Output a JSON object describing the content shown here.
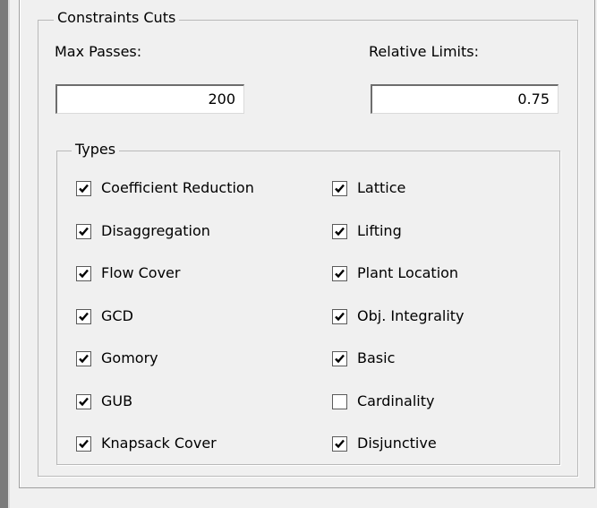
{
  "constraints_cuts": {
    "title": "Constraints Cuts",
    "max_passes": {
      "label": "Max Passes:",
      "value": "200"
    },
    "relative_limits": {
      "label": "Relative Limits:",
      "value": "0.75"
    },
    "types": {
      "title": "Types",
      "left": [
        {
          "label": "Coefficient Reduction",
          "checked": true
        },
        {
          "label": "Disaggregation",
          "checked": true
        },
        {
          "label": "Flow Cover",
          "checked": true
        },
        {
          "label": "GCD",
          "checked": true
        },
        {
          "label": "Gomory",
          "checked": true
        },
        {
          "label": "GUB",
          "checked": true
        },
        {
          "label": "Knapsack Cover",
          "checked": true
        }
      ],
      "right": [
        {
          "label": "Lattice",
          "checked": true
        },
        {
          "label": "Lifting",
          "checked": true
        },
        {
          "label": "Plant Location",
          "checked": true
        },
        {
          "label": "Obj. Integrality",
          "checked": true
        },
        {
          "label": "Basic",
          "checked": true
        },
        {
          "label": "Cardinality",
          "checked": false
        },
        {
          "label": "Disjunctive",
          "checked": true
        }
      ]
    }
  }
}
